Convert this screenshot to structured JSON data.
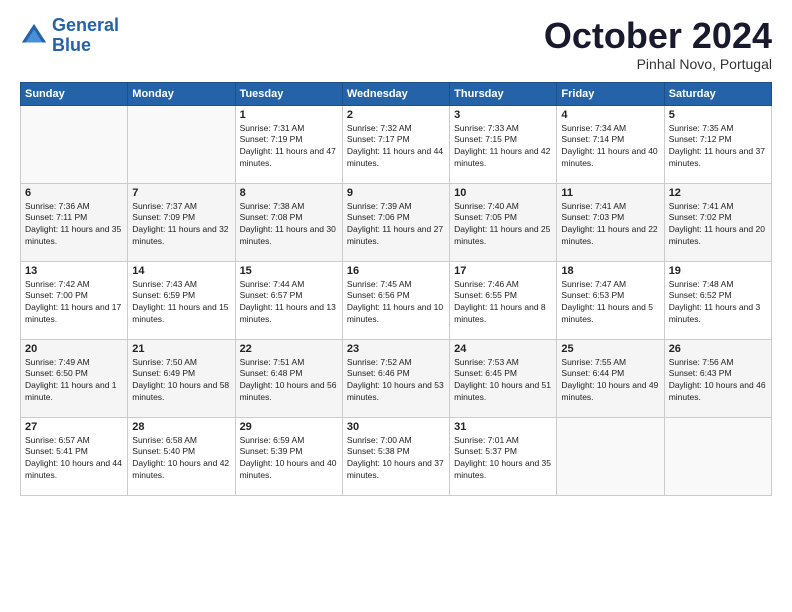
{
  "logo": {
    "line1": "General",
    "line2": "Blue"
  },
  "header": {
    "month": "October 2024",
    "location": "Pinhal Novo, Portugal"
  },
  "weekdays": [
    "Sunday",
    "Monday",
    "Tuesday",
    "Wednesday",
    "Thursday",
    "Friday",
    "Saturday"
  ],
  "weeks": [
    [
      {
        "day": "",
        "info": ""
      },
      {
        "day": "",
        "info": ""
      },
      {
        "day": "1",
        "info": "Sunrise: 7:31 AM\nSunset: 7:19 PM\nDaylight: 11 hours and 47 minutes."
      },
      {
        "day": "2",
        "info": "Sunrise: 7:32 AM\nSunset: 7:17 PM\nDaylight: 11 hours and 44 minutes."
      },
      {
        "day": "3",
        "info": "Sunrise: 7:33 AM\nSunset: 7:15 PM\nDaylight: 11 hours and 42 minutes."
      },
      {
        "day": "4",
        "info": "Sunrise: 7:34 AM\nSunset: 7:14 PM\nDaylight: 11 hours and 40 minutes."
      },
      {
        "day": "5",
        "info": "Sunrise: 7:35 AM\nSunset: 7:12 PM\nDaylight: 11 hours and 37 minutes."
      }
    ],
    [
      {
        "day": "6",
        "info": "Sunrise: 7:36 AM\nSunset: 7:11 PM\nDaylight: 11 hours and 35 minutes."
      },
      {
        "day": "7",
        "info": "Sunrise: 7:37 AM\nSunset: 7:09 PM\nDaylight: 11 hours and 32 minutes."
      },
      {
        "day": "8",
        "info": "Sunrise: 7:38 AM\nSunset: 7:08 PM\nDaylight: 11 hours and 30 minutes."
      },
      {
        "day": "9",
        "info": "Sunrise: 7:39 AM\nSunset: 7:06 PM\nDaylight: 11 hours and 27 minutes."
      },
      {
        "day": "10",
        "info": "Sunrise: 7:40 AM\nSunset: 7:05 PM\nDaylight: 11 hours and 25 minutes."
      },
      {
        "day": "11",
        "info": "Sunrise: 7:41 AM\nSunset: 7:03 PM\nDaylight: 11 hours and 22 minutes."
      },
      {
        "day": "12",
        "info": "Sunrise: 7:41 AM\nSunset: 7:02 PM\nDaylight: 11 hours and 20 minutes."
      }
    ],
    [
      {
        "day": "13",
        "info": "Sunrise: 7:42 AM\nSunset: 7:00 PM\nDaylight: 11 hours and 17 minutes."
      },
      {
        "day": "14",
        "info": "Sunrise: 7:43 AM\nSunset: 6:59 PM\nDaylight: 11 hours and 15 minutes."
      },
      {
        "day": "15",
        "info": "Sunrise: 7:44 AM\nSunset: 6:57 PM\nDaylight: 11 hours and 13 minutes."
      },
      {
        "day": "16",
        "info": "Sunrise: 7:45 AM\nSunset: 6:56 PM\nDaylight: 11 hours and 10 minutes."
      },
      {
        "day": "17",
        "info": "Sunrise: 7:46 AM\nSunset: 6:55 PM\nDaylight: 11 hours and 8 minutes."
      },
      {
        "day": "18",
        "info": "Sunrise: 7:47 AM\nSunset: 6:53 PM\nDaylight: 11 hours and 5 minutes."
      },
      {
        "day": "19",
        "info": "Sunrise: 7:48 AM\nSunset: 6:52 PM\nDaylight: 11 hours and 3 minutes."
      }
    ],
    [
      {
        "day": "20",
        "info": "Sunrise: 7:49 AM\nSunset: 6:50 PM\nDaylight: 11 hours and 1 minute."
      },
      {
        "day": "21",
        "info": "Sunrise: 7:50 AM\nSunset: 6:49 PM\nDaylight: 10 hours and 58 minutes."
      },
      {
        "day": "22",
        "info": "Sunrise: 7:51 AM\nSunset: 6:48 PM\nDaylight: 10 hours and 56 minutes."
      },
      {
        "day": "23",
        "info": "Sunrise: 7:52 AM\nSunset: 6:46 PM\nDaylight: 10 hours and 53 minutes."
      },
      {
        "day": "24",
        "info": "Sunrise: 7:53 AM\nSunset: 6:45 PM\nDaylight: 10 hours and 51 minutes."
      },
      {
        "day": "25",
        "info": "Sunrise: 7:55 AM\nSunset: 6:44 PM\nDaylight: 10 hours and 49 minutes."
      },
      {
        "day": "26",
        "info": "Sunrise: 7:56 AM\nSunset: 6:43 PM\nDaylight: 10 hours and 46 minutes."
      }
    ],
    [
      {
        "day": "27",
        "info": "Sunrise: 6:57 AM\nSunset: 5:41 PM\nDaylight: 10 hours and 44 minutes."
      },
      {
        "day": "28",
        "info": "Sunrise: 6:58 AM\nSunset: 5:40 PM\nDaylight: 10 hours and 42 minutes."
      },
      {
        "day": "29",
        "info": "Sunrise: 6:59 AM\nSunset: 5:39 PM\nDaylight: 10 hours and 40 minutes."
      },
      {
        "day": "30",
        "info": "Sunrise: 7:00 AM\nSunset: 5:38 PM\nDaylight: 10 hours and 37 minutes."
      },
      {
        "day": "31",
        "info": "Sunrise: 7:01 AM\nSunset: 5:37 PM\nDaylight: 10 hours and 35 minutes."
      },
      {
        "day": "",
        "info": ""
      },
      {
        "day": "",
        "info": ""
      }
    ]
  ]
}
